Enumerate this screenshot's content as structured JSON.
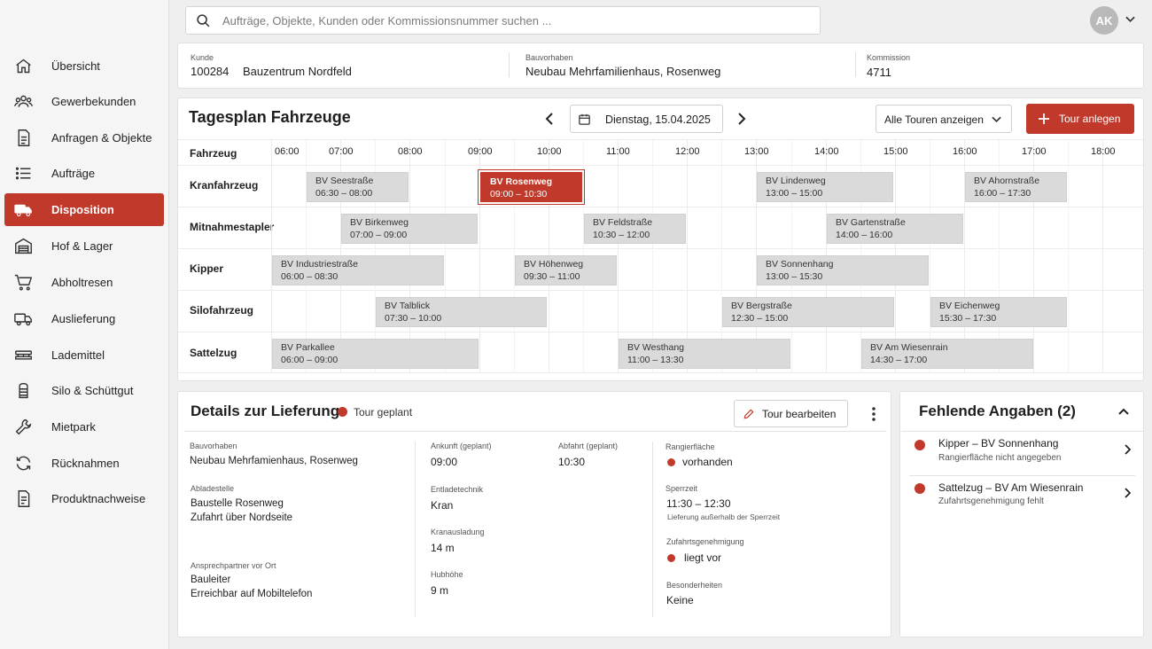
{
  "search": {
    "placeholder": "Aufträge, Objekte, Kunden oder Kommissionsnummer suchen ..."
  },
  "user": {
    "initials": "AK"
  },
  "sidebar": {
    "items": [
      {
        "label": "Übersicht",
        "icon": "home-icon"
      },
      {
        "label": "Gewerbekunden",
        "icon": "users-icon"
      },
      {
        "label": "Anfragen & Objekte",
        "icon": "document-icon"
      },
      {
        "label": "Aufträge",
        "icon": "list-icon"
      },
      {
        "label": "Disposition",
        "icon": "truck-icon",
        "active": true
      },
      {
        "label": "Hof & Lager",
        "icon": "warehouse-icon"
      },
      {
        "label": "Abholtresen",
        "icon": "cart-icon"
      },
      {
        "label": "Auslieferung",
        "icon": "delivery-truck-icon"
      },
      {
        "label": "Lademittel",
        "icon": "pallet-icon"
      },
      {
        "label": "Silo & Schüttgut",
        "icon": "silo-icon"
      },
      {
        "label": "Mietpark",
        "icon": "wrench-icon"
      },
      {
        "label": "Rücknahmen",
        "icon": "refresh-icon"
      },
      {
        "label": "Produktnachweise",
        "icon": "certificate-icon"
      }
    ]
  },
  "info": {
    "kunde_label": "Kunde",
    "kunde_nr": "100284",
    "kunde_name": "Bauzentrum Nordfeld",
    "bv_label": "Bauvorhaben",
    "bv_value": "Neubau Mehrfamilienhaus, Rosenweg",
    "kom_label": "Kommission",
    "kom_value": "4711"
  },
  "planner": {
    "title": "Tagesplan Fahrzeuge",
    "date": "Dienstag, 15.04.2025",
    "filter": "Alle Touren anzeigen",
    "add_button": "Tour anlegen",
    "column_header": "Fahrzeug",
    "times": [
      "06:00",
      "07:00",
      "08:00",
      "09:00",
      "10:00",
      "11:00",
      "12:00",
      "13:00",
      "14:00",
      "15:00",
      "16:00",
      "17:00",
      "18:00"
    ],
    "rows": [
      {
        "vehicle": "Kranfahrzeug",
        "tours": [
          {
            "name": "BV Seestraße",
            "start": "06:30",
            "end": "08:00",
            "range": "06:30 – 08:00"
          },
          {
            "name": "BV Rosenweg",
            "start": "09:00",
            "end": "10:30",
            "range": "09:00 – 10:30",
            "selected": true
          },
          {
            "name": "BV Lindenweg",
            "start": "13:00",
            "end": "15:00",
            "range": "13:00 – 15:00"
          },
          {
            "name": "BV Ahornstraße",
            "start": "16:00",
            "end": "17:30",
            "range": "16:00 – 17:30"
          }
        ]
      },
      {
        "vehicle": "Mitnahmestapler",
        "tours": [
          {
            "name": "BV Birkenweg",
            "start": "07:00",
            "end": "09:00",
            "range": "07:00 – 09:00"
          },
          {
            "name": "BV Feldstraße",
            "start": "10:30",
            "end": "12:00",
            "range": "10:30 – 12:00"
          },
          {
            "name": "BV Gartenstraße",
            "start": "14:00",
            "end": "16:00",
            "range": "14:00 – 16:00"
          }
        ]
      },
      {
        "vehicle": "Kipper",
        "tours": [
          {
            "name": "BV Industriestraße",
            "start": "06:00",
            "end": "08:30",
            "range": "06:00 – 08:30"
          },
          {
            "name": "BV Höhenweg",
            "start": "09:30",
            "end": "11:00",
            "range": "09:30 – 11:00"
          },
          {
            "name": "BV Sonnenhang",
            "start": "13:00",
            "end": "15:30",
            "range": "13:00 – 15:30"
          }
        ]
      },
      {
        "vehicle": "Silofahrzeug",
        "tours": [
          {
            "name": "BV Talblick",
            "start": "07:30",
            "end": "10:00",
            "range": "07:30 – 10:00"
          },
          {
            "name": "BV Bergstraße",
            "start": "12:30",
            "end": "15:00",
            "range": "12:30 – 15:00"
          },
          {
            "name": "BV Eichenweg",
            "start": "15:30",
            "end": "17:30",
            "range": "15:30 – 17:30"
          }
        ]
      },
      {
        "vehicle": "Sattelzug",
        "tours": [
          {
            "name": "BV Parkallee",
            "start": "06:00",
            "end": "09:00",
            "range": "06:00 – 09:00"
          },
          {
            "name": "BV Westhang",
            "start": "11:00",
            "end": "13:30",
            "range": "11:00 – 13:30"
          },
          {
            "name": "BV Am Wiesenrain",
            "start": "14:30",
            "end": "17:00",
            "range": "14:30 – 17:00"
          }
        ]
      }
    ]
  },
  "details": {
    "title": "Details zur Lieferung",
    "status": "Tour geplant",
    "edit_button": "Tour bearbeiten",
    "bv_label": "Bauvorhaben",
    "bv_value": "Neubau Mehrfamienhaus, Rosenweg",
    "abl_label": "Abladestelle",
    "abl_line1": "Baustelle Rosenweg",
    "abl_line2": "Zufahrt über Nordseite",
    "ap_label": "Ansprechpartner vor Ort",
    "ap_line1": "Bauleiter",
    "ap_line2": "Erreichbar auf Mobiltelefon",
    "ankunft_label": "Ankunft (geplant)",
    "ankunft_value": "09:00",
    "abfahrt_label": "Abfahrt (geplant)",
    "abfahrt_value": "10:30",
    "entlade_label": "Entladetechnik",
    "entlade_value": "Kran",
    "ausladung_label": "Kranausladung",
    "ausladung_value": "14 m",
    "hub_label": "Hubhöhe",
    "hub_value": "9 m",
    "rangier_label": "Rangierfläche",
    "rangier_value": "vorhanden",
    "sperr_label": "Sperrzeit",
    "sperr_value": "11:30 – 12:30",
    "sperr_note": "Lieferung außerhalb der Sperrzeit",
    "zufahrt_label": "Zufahrtsgenehmigung",
    "zufahrt_value": "liegt vor",
    "besonder_label": "Besonderheiten",
    "besonder_value": "Keine"
  },
  "missing": {
    "title": "Fehlende Angaben (2)",
    "items": [
      {
        "title": "Kipper – BV Sonnenhang",
        "sub": "Rangierfläche nicht angegeben"
      },
      {
        "title": "Sattelzug – BV Am Wiesenrain",
        "sub": "Zufahrtsgenehmigung fehlt"
      }
    ]
  },
  "colors": {
    "accent": "#c0392b",
    "block": "#dadada"
  }
}
